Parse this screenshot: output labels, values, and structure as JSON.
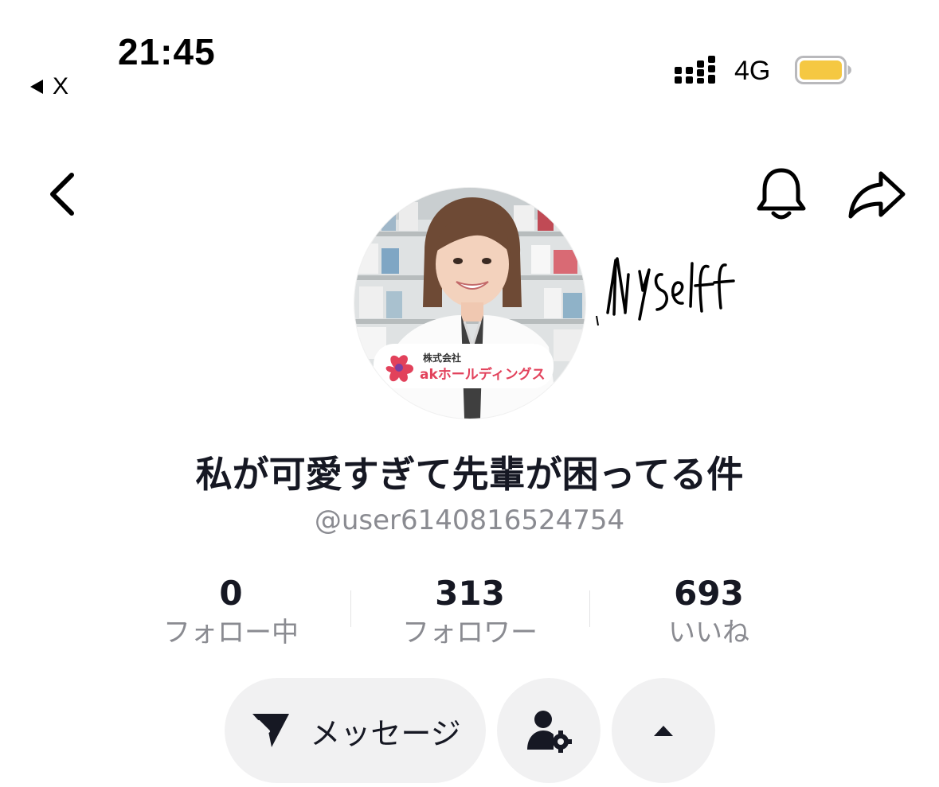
{
  "status_bar": {
    "time": "21:45",
    "back_label": "X",
    "network": "4G",
    "battery_color": "#f5c842"
  },
  "nav": {
    "back_icon": "chevron-left-icon",
    "bell_icon": "bell-icon",
    "share_icon": "share-arrow-icon"
  },
  "avatar": {
    "logo_line1": "株式会社",
    "logo_line2": "akホールディングス",
    "handwritten_note": "Myself"
  },
  "profile": {
    "display_name": "私が可愛すぎて先輩が困ってる件",
    "username": "@user6140816524754"
  },
  "stats": [
    {
      "value": "0",
      "label": "フォロー中"
    },
    {
      "value": "313",
      "label": "フォロワー"
    },
    {
      "value": "693",
      "label": "いいね"
    }
  ],
  "actions": {
    "message_label": "メッセージ",
    "message_icon": "send-icon",
    "user_icon": "user-settings-icon",
    "more_icon": "caret-up-icon"
  },
  "colors": {
    "primary_text": "#161823",
    "secondary_text": "#8a8b91",
    "button_bg": "#f1f1f2"
  }
}
